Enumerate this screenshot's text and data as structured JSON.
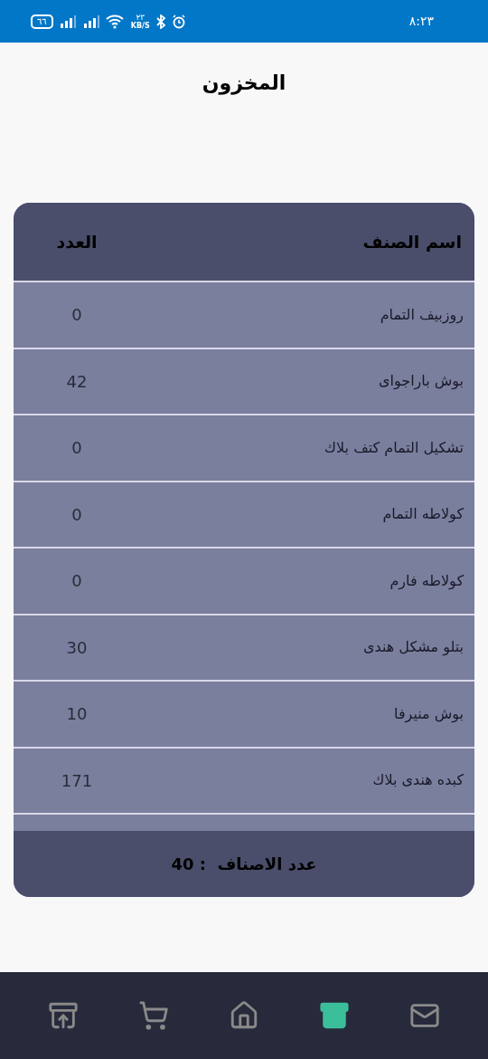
{
  "status_bar": {
    "time": "٨:٢٣",
    "battery": "٦٦",
    "speed_value": "٢٣",
    "speed_unit": "KB/S"
  },
  "title": "المخزون",
  "table": {
    "columns": [
      "اسم الصنف",
      "العدد"
    ],
    "rows": [
      [
        "روزبيف التمام",
        "0"
      ],
      [
        "بوش باراجواى",
        "42"
      ],
      [
        "تشكيل التمام كتف بلاك",
        "0"
      ],
      [
        "كولاطه التمام",
        "0"
      ],
      [
        "كولاطه فارم",
        "0"
      ],
      [
        "بتلو مشكل هندى",
        "30"
      ],
      [
        "بوش منيرفا",
        "10"
      ],
      [
        "كبده هندى بلاك",
        "171"
      ]
    ],
    "footer": "عدد الاصناف  : 40"
  },
  "nav": [
    {
      "kind": "mail",
      "selected": false
    },
    {
      "kind": "archive",
      "selected": true
    },
    {
      "kind": "home",
      "selected": false
    },
    {
      "kind": "cart",
      "selected": false
    },
    {
      "kind": "download",
      "selected": false
    }
  ]
}
